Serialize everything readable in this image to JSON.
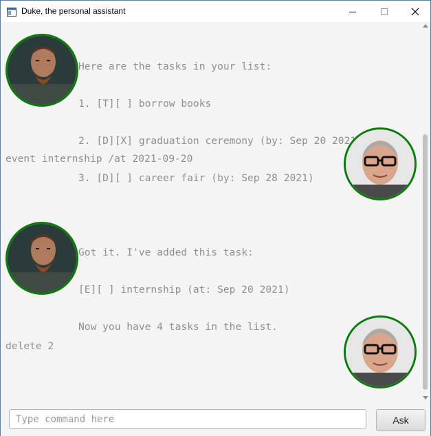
{
  "window": {
    "title": "Duke, the personal assistant"
  },
  "messages": [
    {
      "speaker": "duke",
      "lines": [
        "Here are the tasks in your list:",
        "1. [T][ ] borrow books",
        "2. [D][X] graduation ceremony (by: Sep 20 2021)",
        "3. [D][ ] career fair (by: Sep 28 2021)"
      ]
    },
    {
      "speaker": "user",
      "lines": [
        "event internship /at 2021-09-20"
      ]
    },
    {
      "speaker": "duke",
      "lines": [
        "Got it. I've added this task:",
        "[E][ ] internship (at: Sep 20 2021)",
        "Now you have 4 tasks in the list."
      ]
    },
    {
      "speaker": "user",
      "lines": [
        "delete 2"
      ]
    }
  ],
  "input": {
    "placeholder": "Type command here",
    "value": ""
  },
  "ask_button": {
    "label": "Ask"
  },
  "colors": {
    "avatar_border": "#0a7a0a",
    "message_text": "#8f8f8f",
    "background": "#f4f4f4"
  },
  "icons": {
    "duke_avatar": "bearded-man-avatar",
    "user_avatar": "man-with-glasses-avatar"
  }
}
